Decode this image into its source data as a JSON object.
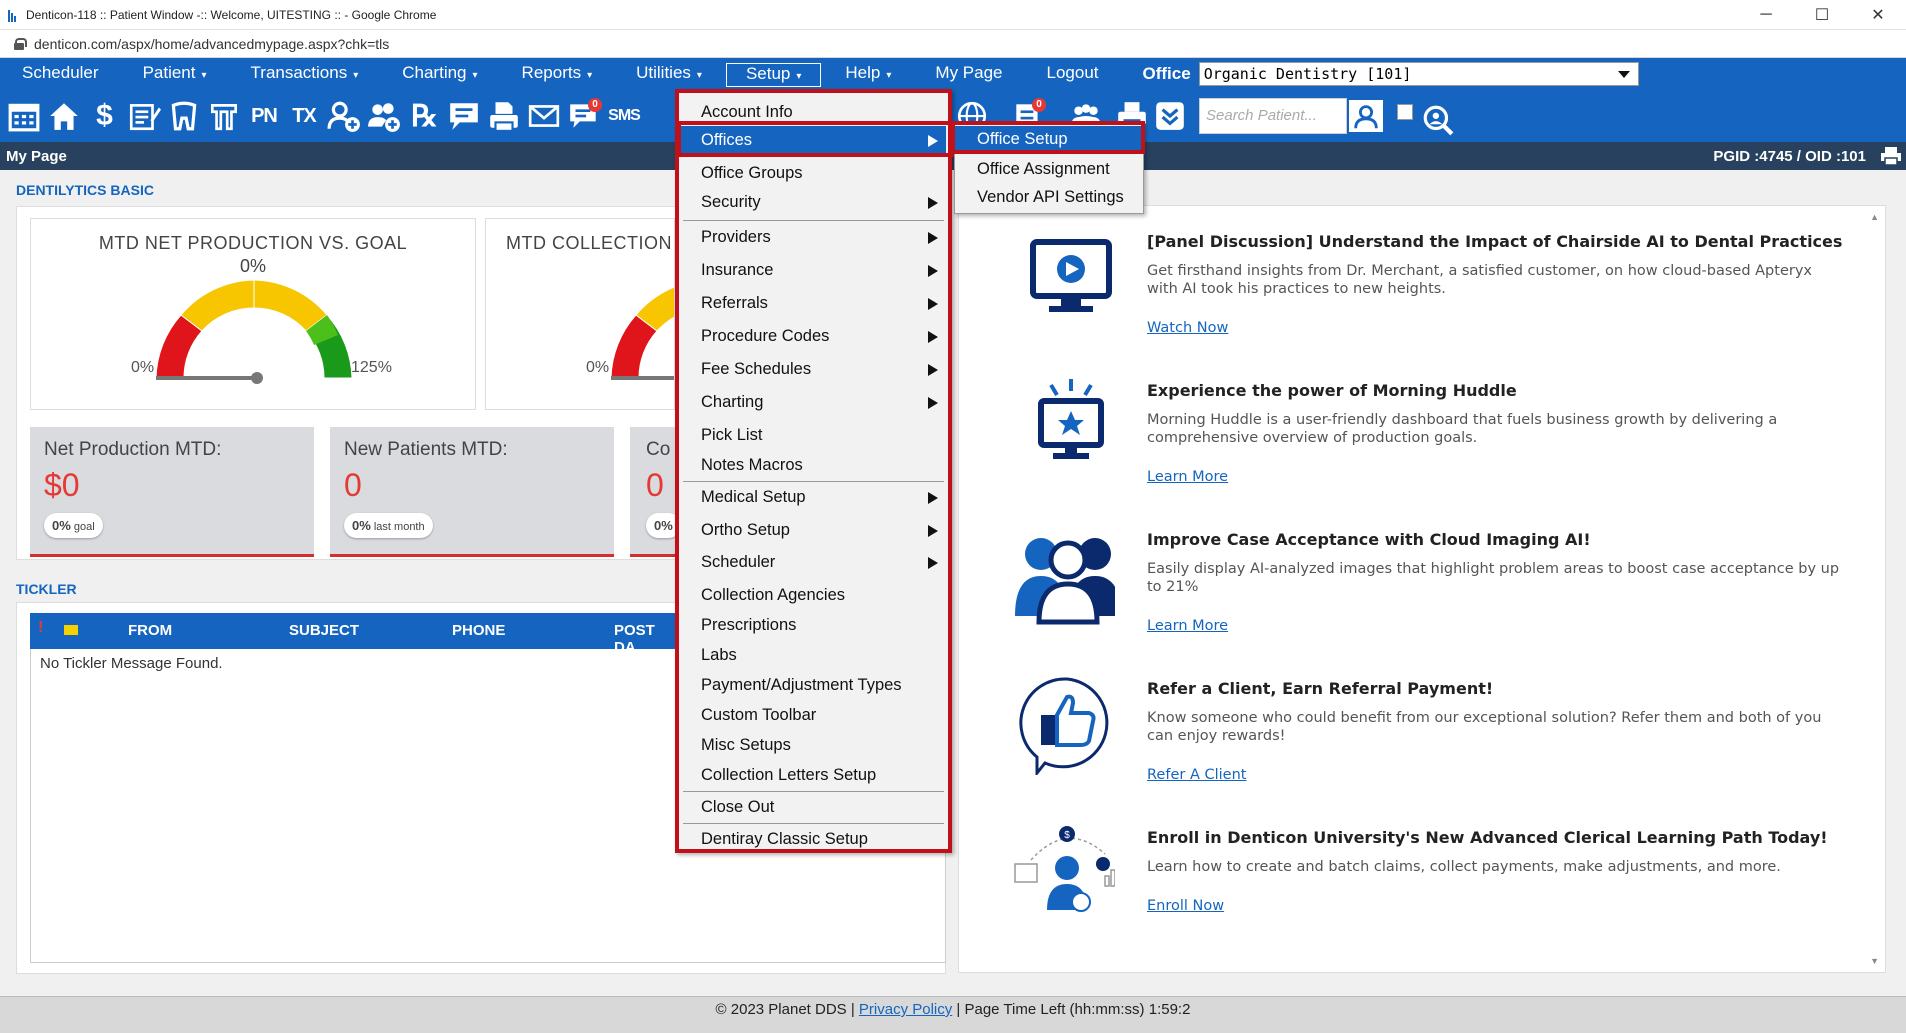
{
  "browser": {
    "window_title": "Denticon-118 :: Patient Window -:: Welcome, UITESTING :: - Google Chrome",
    "url": "denticon.com/aspx/home/advancedmypage.aspx?chk=tls",
    "minimize": "─",
    "maximize": "☐",
    "close": "✕"
  },
  "nav": {
    "items": [
      {
        "label": "Scheduler",
        "caret": ""
      },
      {
        "label": "Patient",
        "caret": "▾"
      },
      {
        "label": "Transactions",
        "caret": "▾"
      },
      {
        "label": "Charting",
        "caret": "▾"
      },
      {
        "label": "Reports",
        "caret": "▾"
      },
      {
        "label": "Utilities",
        "caret": "▾"
      },
      {
        "label": "Setup",
        "caret": "▾"
      },
      {
        "label": "Help",
        "caret": "▾"
      },
      {
        "label": "My Page",
        "caret": ""
      },
      {
        "label": "Logout",
        "caret": ""
      }
    ],
    "office_label": "Office",
    "office_value": "Organic Dentistry [101]"
  },
  "toolbar": {
    "search_placeholder": "Search Patient...",
    "icons": [
      "calendar-icon",
      "home-icon",
      "dollar-icon",
      "notes-icon",
      "tooth-icon",
      "teeth-icon",
      "pn-icon",
      "tx-icon",
      "add-patient-icon",
      "add-group-icon",
      "rx-icon",
      "message-icon",
      "print-form-icon",
      "email-icon",
      "chat-icon",
      "sms-icon"
    ],
    "badge_chat": "0",
    "badge_doc": "0"
  },
  "page": {
    "title": "My Page",
    "ids": "PGID :4745  /  OID :101"
  },
  "dentilytics": {
    "section_title": "DENTILYTICS BASIC",
    "gauge1": {
      "title": "MTD NET PRODUCTION VS. GOAL",
      "value": "0%",
      "min": "0%",
      "max": "125%",
      "level": 0
    },
    "gauge2": {
      "title": "MTD COLLECTION",
      "min": "0%"
    },
    "stats": [
      {
        "label": "Net Production MTD:",
        "value": "$0",
        "pill_value": "0%",
        "pill_text": "goal"
      },
      {
        "label": "New Patients MTD:",
        "value": "0",
        "pill_value": "0%",
        "pill_text": "last month"
      },
      {
        "label": "Co",
        "value": "0",
        "pill_value": "0%",
        "pill_text": ""
      }
    ]
  },
  "tickler": {
    "section_title": "TICKLER",
    "columns": [
      "FROM",
      "SUBJECT",
      "PHONE",
      "POST DA"
    ],
    "empty_text": "No Tickler Message Found."
  },
  "news": [
    {
      "title": "[Panel Discussion] Understand the Impact of Chairside AI to Dental Practices",
      "text": "Get firsthand insights from Dr. Merchant, a satisfied customer, on how cloud-based Apteryx with AI took his practices to new heights.",
      "link": "Watch Now"
    },
    {
      "title": "Experience the power of Morning Huddle",
      "text": "Morning Huddle is a user-friendly dashboard that fuels business growth by delivering a comprehensive overview of production goals.",
      "link": "Learn More"
    },
    {
      "title": "Improve Case Acceptance with Cloud Imaging AI!",
      "text": "Easily display AI-analyzed images that highlight problem areas to boost case acceptance by up to 21%",
      "link": "Learn More"
    },
    {
      "title": "Refer a Client, Earn Referral Payment!",
      "text": "Know someone who could benefit from our exceptional solution? Refer them and both of you can enjoy rewards!",
      "link": "Refer A Client"
    },
    {
      "title": "Enroll in Denticon University's New Advanced Clerical Learning Path Today!",
      "text": "Learn how to create and batch claims, collect payments, make adjustments, and more.",
      "link": "Enroll Now"
    }
  ],
  "setup_menu": {
    "items": [
      {
        "label": "Account Info",
        "submenu": false
      },
      {
        "label": "Offices",
        "submenu": true
      },
      {
        "label": "Office Groups",
        "submenu": false
      },
      {
        "label": "Security",
        "submenu": true
      },
      {
        "label": "Providers",
        "submenu": true
      },
      {
        "label": "Insurance",
        "submenu": true
      },
      {
        "label": "Referrals",
        "submenu": true
      },
      {
        "label": "Procedure Codes",
        "submenu": true
      },
      {
        "label": "Fee Schedules",
        "submenu": true
      },
      {
        "label": "Charting",
        "submenu": true
      },
      {
        "label": "Pick List",
        "submenu": false
      },
      {
        "label": "Notes Macros",
        "submenu": false
      },
      {
        "label": "Medical Setup",
        "submenu": true
      },
      {
        "label": "Ortho Setup",
        "submenu": true
      },
      {
        "label": "Scheduler",
        "submenu": true
      },
      {
        "label": "Collection Agencies",
        "submenu": false
      },
      {
        "label": "Prescriptions",
        "submenu": false
      },
      {
        "label": "Labs",
        "submenu": false
      },
      {
        "label": "Payment/Adjustment Types",
        "submenu": false
      },
      {
        "label": "Custom Toolbar",
        "submenu": false
      },
      {
        "label": "Misc Setups",
        "submenu": false
      },
      {
        "label": "Collection Letters Setup",
        "submenu": false
      },
      {
        "label": "Close Out",
        "submenu": false
      },
      {
        "label": "Dentiray Classic Setup",
        "submenu": false
      }
    ],
    "offices_submenu": [
      "Office Setup",
      "Office Assignment",
      "Vendor API Settings"
    ]
  },
  "footer": {
    "copyright": "© 2023 Planet DDS | ",
    "privacy": "Privacy Policy",
    "time_left": " | Page Time Left (hh:mm:ss) 1:59:2"
  },
  "colors": {
    "primary": "#1565c0",
    "header_dark": "#27415e",
    "highlight_red": "#c0101a",
    "value_red": "#e53935"
  }
}
